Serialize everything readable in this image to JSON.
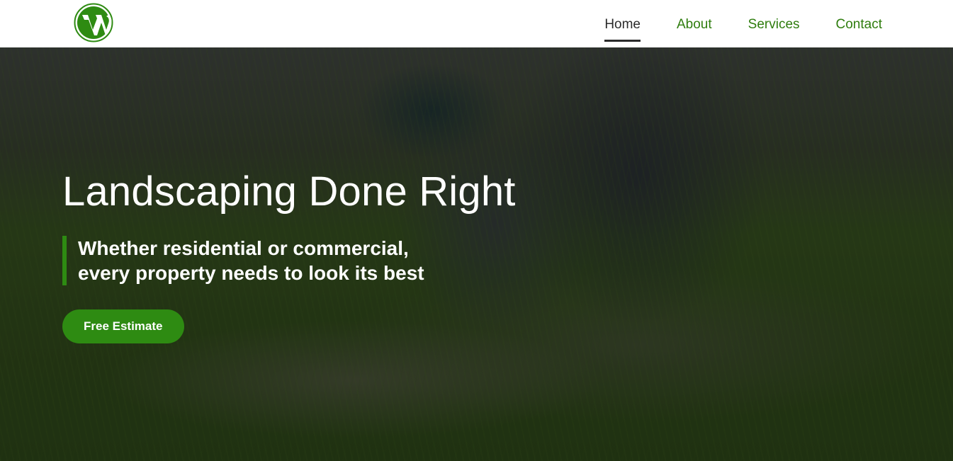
{
  "logo": {
    "icon": "wordpress-logo",
    "color": "#2e8b12"
  },
  "nav": {
    "items": [
      {
        "label": "Home",
        "active": true
      },
      {
        "label": "About",
        "active": false
      },
      {
        "label": "Services",
        "active": false
      },
      {
        "label": "Contact",
        "active": false
      }
    ]
  },
  "hero": {
    "title": "Landscaping Done Right",
    "subtitle_line1": "Whether residential or commercial,",
    "subtitle_line2": "every property needs to look its best",
    "cta_label": "Free Estimate"
  },
  "colors": {
    "accent": "#2e8b12",
    "nav_link": "#2f7d0e",
    "nav_active": "#2b2b2b"
  }
}
